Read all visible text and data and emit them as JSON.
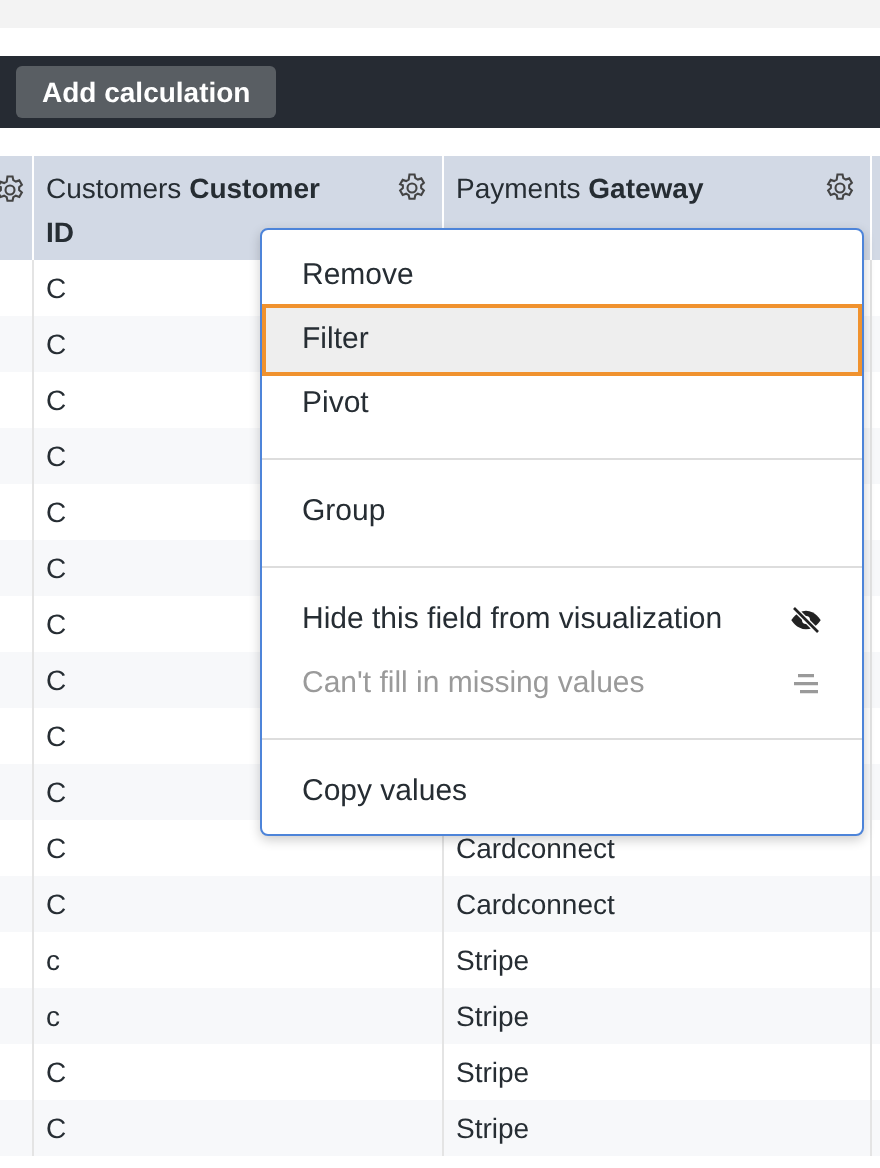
{
  "toolbar": {
    "button": "Add calculation"
  },
  "table": {
    "columns": [
      {
        "label_plain": "Customers ",
        "label_bold": "Customer ID"
      },
      {
        "label_plain": "Payments ",
        "label_bold": "Gateway"
      }
    ],
    "rows": [
      {
        "customer": "C"
      },
      {
        "customer": "C"
      },
      {
        "customer": "C"
      },
      {
        "customer": "C"
      },
      {
        "customer": "C"
      },
      {
        "customer": "C"
      },
      {
        "customer": "C"
      },
      {
        "customer": "C"
      },
      {
        "customer": "C"
      },
      {
        "customer": "C"
      },
      {
        "customer": "C",
        "gateway": "Cardconnect"
      },
      {
        "customer": "C",
        "gateway": "Cardconnect"
      },
      {
        "customer": "c",
        "gateway": "Stripe"
      },
      {
        "customer": "c",
        "gateway": "Stripe"
      },
      {
        "customer": "C",
        "gateway": "Stripe"
      },
      {
        "customer": "C",
        "gateway": "Stripe"
      }
    ]
  },
  "menu": {
    "items": [
      {
        "kind": "item",
        "label": "Remove",
        "selected": false,
        "disabled": false
      },
      {
        "kind": "item",
        "label": "Filter",
        "selected": true,
        "disabled": false
      },
      {
        "kind": "item",
        "label": "Pivot",
        "selected": false,
        "disabled": false
      },
      {
        "kind": "divider"
      },
      {
        "kind": "item",
        "label": "Group",
        "selected": false,
        "disabled": false
      },
      {
        "kind": "divider"
      },
      {
        "kind": "iconitem",
        "label": "Hide this field from visualization",
        "selected": false,
        "disabled": false
      },
      {
        "kind": "iconitem",
        "label": "Can't fill in missing values",
        "selected": false,
        "disabled": true
      },
      {
        "kind": "divider"
      },
      {
        "kind": "item",
        "label": "Copy values",
        "selected": false,
        "disabled": false
      }
    ]
  }
}
